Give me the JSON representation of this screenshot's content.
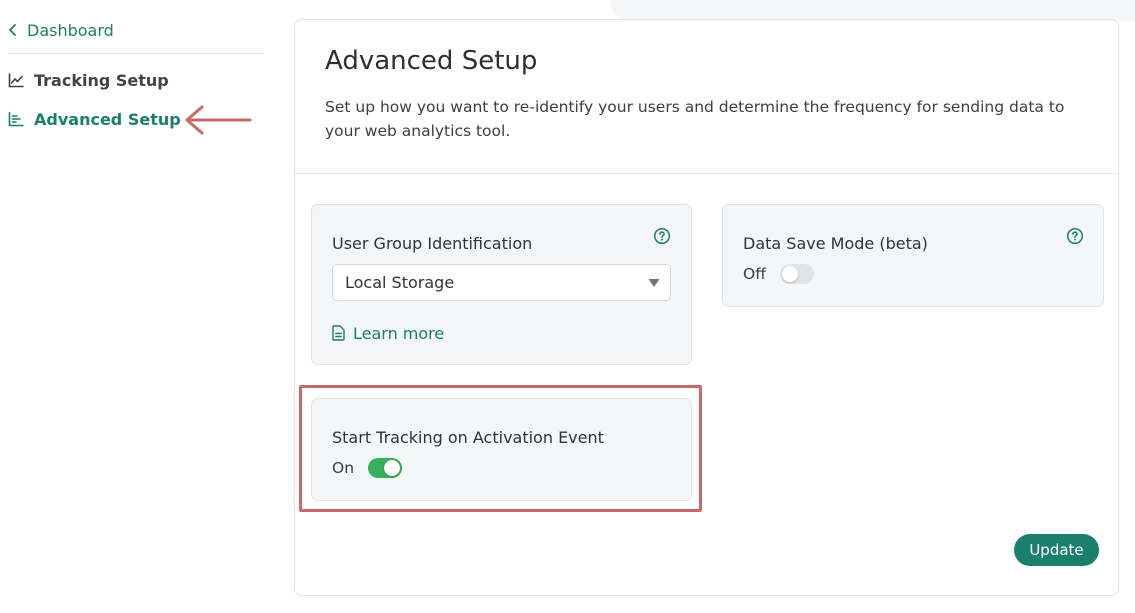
{
  "sidebar": {
    "back_label": "Dashboard",
    "items": [
      {
        "label": "Tracking Setup",
        "icon": "line-chart-icon",
        "active": false
      },
      {
        "label": "Advanced Setup",
        "icon": "bar-list-icon",
        "active": true
      }
    ]
  },
  "main": {
    "title": "Advanced Setup",
    "description": "Set up how you want to re-identify your users and determine the frequency for sending data to your web analytics tool.",
    "user_group": {
      "label": "User Group Identification",
      "selected": "Local Storage",
      "learn_more": "Learn more"
    },
    "data_save_mode": {
      "label": "Data Save Mode (beta)",
      "state_label": "Off",
      "enabled": false
    },
    "start_tracking": {
      "label": "Start Tracking on Activation Event",
      "state_label": "On",
      "enabled": true
    },
    "update_label": "Update"
  },
  "colors": {
    "accent": "#1b7f6e",
    "toggle_on": "#36b05a",
    "annotation": "#c96a6a",
    "panel_bg": "#f4f6f8"
  }
}
